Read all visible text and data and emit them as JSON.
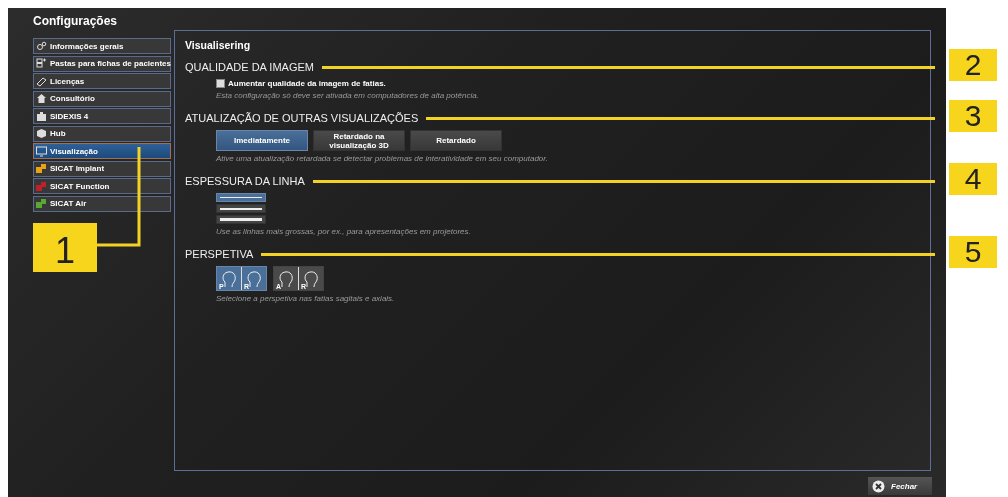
{
  "window": {
    "title": "Configurações"
  },
  "sidebar": {
    "items": [
      {
        "label": "Informações gerais",
        "selected": false
      },
      {
        "label": "Pastas para fichas de pacientes",
        "selected": false
      },
      {
        "label": "Licenças",
        "selected": false
      },
      {
        "label": "Consultório",
        "selected": false
      },
      {
        "label": "SIDEXIS 4",
        "selected": false
      },
      {
        "label": "Hub",
        "selected": false
      },
      {
        "label": "Visualização",
        "selected": true
      },
      {
        "label": "SICAT Implant",
        "color": "#e8a317",
        "selected": false
      },
      {
        "label": "SICAT Function",
        "color": "#c0202a",
        "selected": false
      },
      {
        "label": "SICAT Air",
        "color": "#5aa832",
        "selected": false
      }
    ],
    "callout": "1"
  },
  "panel": {
    "title": "Visualisering",
    "sections": [
      {
        "kind": "checkbox",
        "heading": "QUALIDADE DA IMAGEM",
        "callout": "2",
        "label": "Aumentar qualidade da imagem de fatias.",
        "checked": false,
        "hint": "Esta configuração só deve ser ativada em computadores de alta potência."
      },
      {
        "kind": "buttons",
        "heading": "ATUALIZAÇÃO DE OUTRAS VISUALIZAÇÕES",
        "callout": "3",
        "options": [
          {
            "label": "Imediatamente",
            "selected": true
          },
          {
            "label": "Retardado na visualização 3D",
            "selected": false
          },
          {
            "label": "Retardado",
            "selected": false
          }
        ],
        "hint": "Ative uma atualização retardada se detectar problemas de interatividade em seu computador."
      },
      {
        "kind": "lines",
        "heading": "ESPESSURA DA LINHA",
        "callout": "4",
        "options": [
          {
            "selected": true
          },
          {
            "selected": false
          },
          {
            "selected": false
          }
        ],
        "hint": "Use as linhas mais grossas, por ex., para apresentações em projetores."
      },
      {
        "kind": "perspective",
        "heading": "PERSPETIVA",
        "callout": "5",
        "options": [
          {
            "left": "P",
            "right": "R",
            "selected": true
          },
          {
            "left": "A",
            "right": "R",
            "selected": false
          }
        ],
        "hint": "Selecione a perspetiva nas fatias sagitais e axiais."
      }
    ]
  },
  "close_button": "Fechar"
}
